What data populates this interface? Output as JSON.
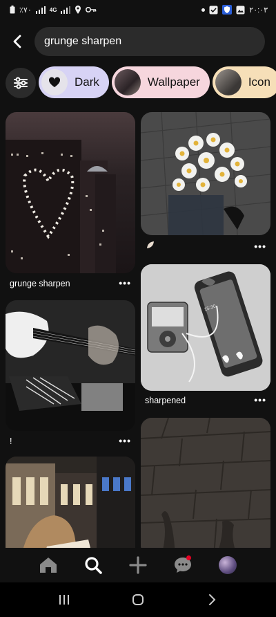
{
  "status_bar": {
    "left_text": "٪٧٠",
    "network": "4G",
    "time": "٢٠:٠٣"
  },
  "search": {
    "query": "grunge sharpen"
  },
  "chips": [
    {
      "label": "Dark"
    },
    {
      "label": "Wallpaper"
    },
    {
      "label": "Icon"
    }
  ],
  "pins": [
    {
      "caption": "grunge sharpen",
      "more": "•••"
    },
    {
      "caption": "",
      "more": "•••"
    },
    {
      "caption": "",
      "more": "•••"
    },
    {
      "caption": "!",
      "more": "•••"
    },
    {
      "caption": "sharpened",
      "more": "•••"
    },
    {
      "caption": "",
      "more": ""
    },
    {
      "caption": "",
      "more": ""
    }
  ],
  "photo_text": {
    "phone_clock": "15:30"
  },
  "icons": {
    "back": "chevron-left-icon",
    "filter": "sliders-icon",
    "home": "home-icon",
    "search": "search-icon",
    "create": "plus-icon",
    "messages": "chat-icon",
    "profile": "avatar",
    "sys_recent": "recent-apps-icon",
    "sys_home": "home-circle-icon",
    "sys_back": "back-chevron-icon"
  },
  "colors": {
    "background": "#111111",
    "search_bg": "#2b2b2b",
    "chip_dark": "#d7d3f5",
    "chip_wallpaper": "#f6d6dd",
    "chip_icon": "#f6dfb8",
    "notification": "#e60023"
  }
}
